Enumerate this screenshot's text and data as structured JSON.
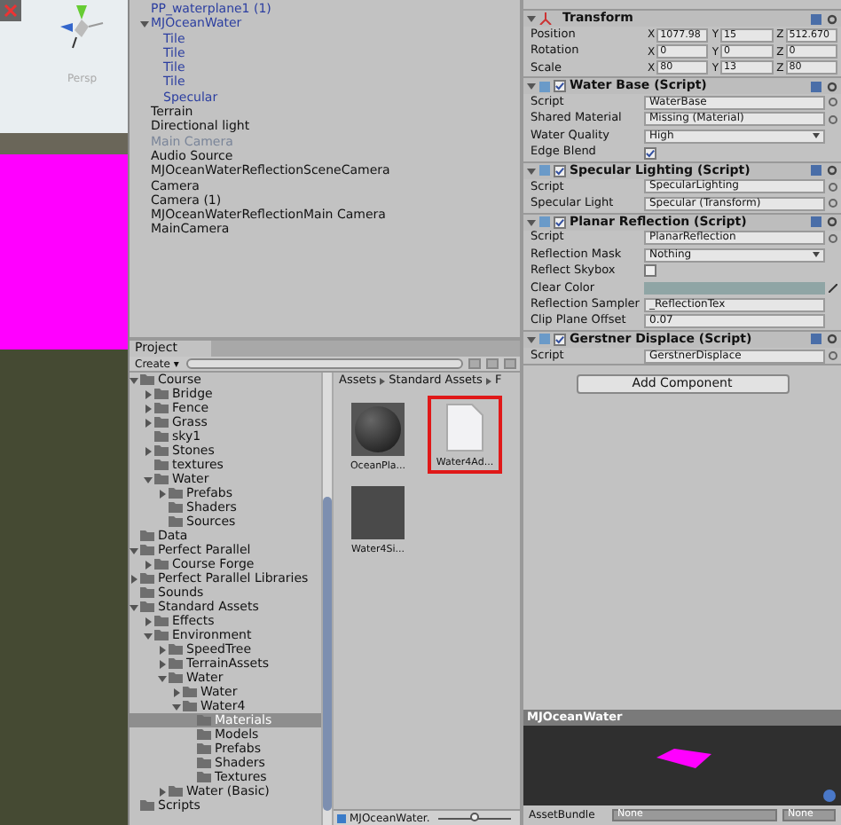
{
  "scene": {
    "view_label": "Persp"
  },
  "hierarchy": {
    "items": [
      {
        "label": "PP_waterplane1 (1)",
        "prefab": true,
        "disabled": false,
        "selected": false
      },
      {
        "label": "MJOceanWater",
        "prefab": true,
        "disabled": false,
        "selected": false,
        "expanded": true,
        "children": [
          {
            "label": "Tile",
            "prefab": true,
            "disabled": false,
            "selected": false
          },
          {
            "label": "Tile",
            "prefab": true,
            "disabled": false,
            "selected": false
          },
          {
            "label": "Tile",
            "prefab": true,
            "disabled": false,
            "selected": false
          },
          {
            "label": "Tile",
            "prefab": true,
            "disabled": false,
            "selected": false
          },
          {
            "label": "Specular",
            "prefab": true,
            "disabled": false,
            "selected": false
          }
        ]
      },
      {
        "label": "Terrain",
        "prefab": false,
        "disabled": false,
        "selected": false
      },
      {
        "label": "Directional light",
        "prefab": false,
        "disabled": false,
        "selected": false
      },
      {
        "label": "Main Camera",
        "prefab": false,
        "disabled": true,
        "selected": false
      },
      {
        "label": "Audio Source",
        "prefab": false,
        "disabled": false,
        "selected": false
      },
      {
        "label": "MJOceanWaterReflectionSceneCamera",
        "prefab": false,
        "disabled": false,
        "selected": false
      },
      {
        "label": "Camera",
        "prefab": false,
        "disabled": false,
        "selected": false
      },
      {
        "label": "Camera (1)",
        "prefab": false,
        "disabled": false,
        "selected": false
      },
      {
        "label": "MJOceanWaterReflectionMain Camera",
        "prefab": false,
        "disabled": false,
        "selected": false
      },
      {
        "label": "MainCamera",
        "prefab": false,
        "disabled": false,
        "selected": false
      }
    ]
  },
  "project": {
    "tab": "Project",
    "create_button": "Create ▾",
    "tree": [
      {
        "label": "Course",
        "expanded": true,
        "selected": false,
        "children": [
          {
            "label": "Bridge",
            "expanded": false,
            "selected": false
          },
          {
            "label": "Fence",
            "expanded": false,
            "selected": false
          },
          {
            "label": "Grass",
            "expanded": false,
            "selected": false
          },
          {
            "label": "sky1",
            "selected": false
          },
          {
            "label": "Stones",
            "expanded": false,
            "selected": false
          },
          {
            "label": "textures",
            "selected": false
          },
          {
            "label": "Water",
            "expanded": true,
            "selected": false,
            "children": [
              {
                "label": "Prefabs",
                "expanded": false,
                "selected": false
              },
              {
                "label": "Shaders",
                "selected": false
              },
              {
                "label": "Sources",
                "selected": false
              }
            ]
          }
        ]
      },
      {
        "label": "Data",
        "selected": false
      },
      {
        "label": "Perfect Parallel",
        "expanded": true,
        "selected": false,
        "children": [
          {
            "label": "Course Forge",
            "expanded": false,
            "selected": false
          }
        ]
      },
      {
        "label": "Perfect Parallel Libraries",
        "expanded": false,
        "selected": false
      },
      {
        "label": "Sounds",
        "selected": false
      },
      {
        "label": "Standard Assets",
        "expanded": true,
        "selected": false,
        "children": [
          {
            "label": "Effects",
            "expanded": false,
            "selected": false
          },
          {
            "label": "Environment",
            "expanded": true,
            "selected": false,
            "children": [
              {
                "label": "SpeedTree",
                "expanded": false,
                "selected": false
              },
              {
                "label": "TerrainAssets",
                "expanded": false,
                "selected": false
              },
              {
                "label": "Water",
                "expanded": true,
                "selected": false,
                "children": [
                  {
                    "label": "Water",
                    "expanded": false,
                    "selected": false
                  },
                  {
                    "label": "Water4",
                    "expanded": true,
                    "selected": false,
                    "children": [
                      {
                        "label": "Materials",
                        "selected": true
                      },
                      {
                        "label": "Models",
                        "selected": false
                      },
                      {
                        "label": "Prefabs",
                        "selected": false
                      },
                      {
                        "label": "Shaders",
                        "selected": false
                      },
                      {
                        "label": "Textures",
                        "selected": false
                      }
                    ]
                  }
                ]
              },
              {
                "label": "Water (Basic)",
                "expanded": false,
                "selected": false
              }
            ]
          }
        ]
      },
      {
        "label": "Scripts",
        "selected": false
      }
    ],
    "breadcrumb": [
      "Assets",
      "Standard Assets",
      "F"
    ],
    "assets": [
      {
        "label": "OceanPla...",
        "kind": "material",
        "highlighted": false
      },
      {
        "label": "Water4Ad...",
        "kind": "file",
        "highlighted": true
      },
      {
        "label": "Water4Si...",
        "kind": "texture",
        "highlighted": false
      }
    ],
    "footer": {
      "label": "MJOceanWater.",
      "zoom": {
        "level": 0.5
      }
    }
  },
  "inspector": {
    "components": [
      {
        "kind": "transform",
        "title": "Transform",
        "rows": [
          {
            "label": "Position",
            "values": [
              {
                "axis": "X",
                "value": "1077.98"
              },
              {
                "axis": "Y",
                "value": "15"
              },
              {
                "axis": "Z",
                "value": "512.670"
              }
            ]
          },
          {
            "label": "Rotation",
            "values": [
              {
                "axis": "X",
                "value": "0"
              },
              {
                "axis": "Y",
                "value": "0"
              },
              {
                "axis": "Z",
                "value": "0"
              }
            ]
          },
          {
            "label": "Scale",
            "values": [
              {
                "axis": "X",
                "value": "80"
              },
              {
                "axis": "Y",
                "value": "13"
              },
              {
                "axis": "Z",
                "value": "80"
              }
            ]
          }
        ]
      },
      {
        "kind": "script",
        "title": "Water Base (Script)",
        "enabled": true,
        "fields": [
          {
            "label": "Script",
            "kind": "object",
            "value": "WaterBase"
          },
          {
            "label": "Shared Material",
            "kind": "object",
            "value": "Missing (Material)"
          },
          {
            "label": "Water Quality",
            "kind": "dropdown",
            "value": "High"
          },
          {
            "label": "Edge Blend",
            "kind": "checkbox",
            "checked": true
          }
        ]
      },
      {
        "kind": "script",
        "title": "Specular Lighting (Script)",
        "enabled": true,
        "fields": [
          {
            "label": "Script",
            "kind": "object",
            "value": "SpecularLighting"
          },
          {
            "label": "Specular Light",
            "kind": "object",
            "value": "Specular (Transform)"
          }
        ]
      },
      {
        "kind": "script",
        "title": "Planar Reflection (Script)",
        "enabled": true,
        "fields": [
          {
            "label": "Script",
            "kind": "object",
            "value": "PlanarReflection"
          },
          {
            "label": "Reflection Mask",
            "kind": "dropdown",
            "value": "Nothing"
          },
          {
            "label": "Reflect Skybox",
            "kind": "checkbox",
            "checked": false
          },
          {
            "label": "Clear Color",
            "kind": "color",
            "color": "#8fa5a5"
          },
          {
            "label": "Reflection Sampler",
            "kind": "text",
            "value": "_ReflectionTex"
          },
          {
            "label": "Clip Plane Offset",
            "kind": "text",
            "value": "0.07"
          }
        ]
      },
      {
        "kind": "script",
        "title": "Gerstner Displace (Script)",
        "enabled": true,
        "fields": [
          {
            "label": "Script",
            "kind": "object",
            "value": "GerstnerDisplace"
          }
        ]
      }
    ],
    "add_button": "Add Component"
  },
  "preview": {
    "title": "MJOceanWater",
    "asset_bundle_label": "AssetBundle",
    "bundle": "None",
    "variant": "None"
  }
}
